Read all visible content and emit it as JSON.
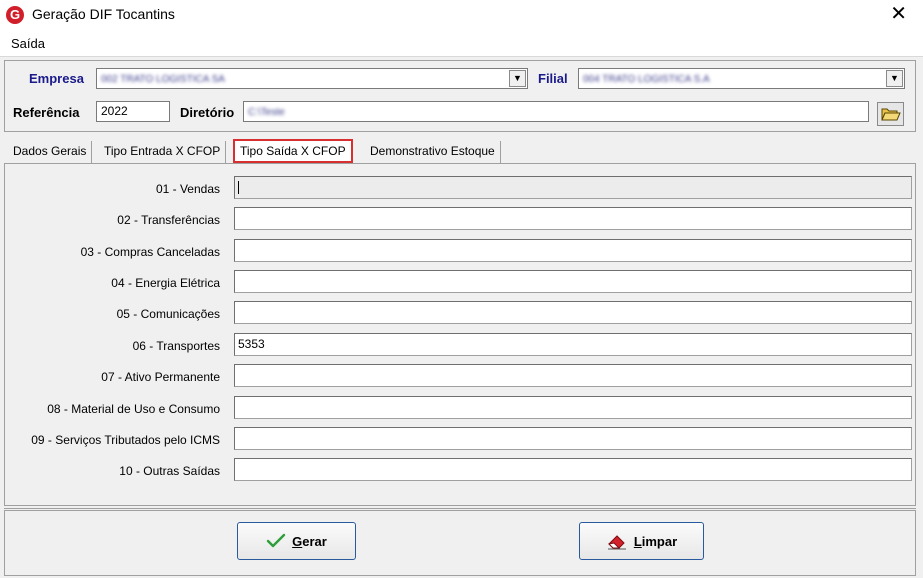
{
  "window": {
    "title": "Geração DIF Tocantins",
    "logo_letter": "G",
    "close_glyph": "✕"
  },
  "menu": {
    "items": [
      "Saída"
    ]
  },
  "header": {
    "empresa_label": "Empresa",
    "empresa_value": "002 TRATO LOGISTICA SA",
    "filial_label": "Filial",
    "filial_value": "004 TRATO LOGISTICA S.A",
    "referencia_label": "Referência",
    "referencia_value": "2022",
    "diretorio_label": "Diretório",
    "diretorio_value": "C:\\Teste"
  },
  "tabs": [
    {
      "label": "Dados Gerais",
      "active": false
    },
    {
      "label": "Tipo Entrada X CFOP",
      "active": false
    },
    {
      "label": "Tipo Saída X CFOP",
      "active": true
    },
    {
      "label": "Demonstrativo Estoque",
      "active": false
    }
  ],
  "rows": [
    {
      "label": "01 - Vendas",
      "value": ""
    },
    {
      "label": "02 - Transferências",
      "value": ""
    },
    {
      "label": "03 - Compras Canceladas",
      "value": ""
    },
    {
      "label": "04 - Energia Elétrica",
      "value": ""
    },
    {
      "label": "05 - Comunicações",
      "value": ""
    },
    {
      "label": "06 - Transportes",
      "value": "5353"
    },
    {
      "label": "07 - Ativo Permanente",
      "value": ""
    },
    {
      "label": "08 - Material de Uso e Consumo",
      "value": ""
    },
    {
      "label": "09 - Serviços Tributados pelo ICMS",
      "value": ""
    },
    {
      "label": "10 - Outras Saídas",
      "value": ""
    }
  ],
  "buttons": {
    "gerar": {
      "first": "G",
      "rest": "erar"
    },
    "limpar": {
      "first": "L",
      "rest": "impar"
    }
  },
  "colors": {
    "accent_blue": "#1a1a8c",
    "tab_highlight": "#d83030",
    "check_green": "#2e9e3a",
    "eraser_red": "#d4202a"
  }
}
